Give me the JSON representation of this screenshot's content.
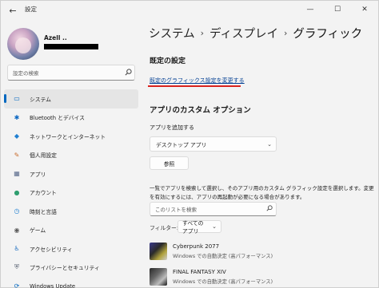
{
  "window": {
    "title": "設定",
    "back_glyph": "←",
    "minimize_glyph": "—",
    "maximize_glyph": "☐",
    "close_glyph": "✕"
  },
  "profile": {
    "name": "Azell .."
  },
  "search": {
    "placeholder": "設定の検索",
    "icon": "search-icon"
  },
  "sidebar": {
    "items": [
      {
        "label": "システム",
        "icon": "monitor-icon",
        "glyph": "▭",
        "color": "#0067c0",
        "active": true
      },
      {
        "label": "Bluetooth とデバイス",
        "icon": "bluetooth-icon",
        "glyph": "✱",
        "color": "#0a66c2"
      },
      {
        "label": "ネットワークとインターネット",
        "icon": "wifi-icon",
        "glyph": "◆",
        "color": "#1f7fd1"
      },
      {
        "label": "個人用設定",
        "icon": "pen-icon",
        "glyph": "✎",
        "color": "#c86b2a"
      },
      {
        "label": "アプリ",
        "icon": "apps-icon",
        "glyph": "▦",
        "color": "#5a6b8c"
      },
      {
        "label": "アカウント",
        "icon": "account-icon",
        "glyph": "●",
        "color": "#2f9e6f"
      },
      {
        "label": "時刻と言語",
        "icon": "globe-clock-icon",
        "glyph": "◷",
        "color": "#1f7fd1"
      },
      {
        "label": "ゲーム",
        "icon": "gamepad-icon",
        "glyph": "◉",
        "color": "#5b5b5b"
      },
      {
        "label": "アクセシビリティ",
        "icon": "accessibility-icon",
        "glyph": "♿",
        "color": "#1f6fc0"
      },
      {
        "label": "プライバシーとセキュリティ",
        "icon": "shield-icon",
        "glyph": "⛨",
        "color": "#5b6474"
      },
      {
        "label": "Windows Update",
        "icon": "update-icon",
        "glyph": "⟳",
        "color": "#0067c0"
      }
    ]
  },
  "breadcrumb": {
    "level1": "システム",
    "level2": "ディスプレイ",
    "current": "グラフィック",
    "separator": "›"
  },
  "default_settings": {
    "title": "既定の設定",
    "link": "既定のグラフィックス設定を変更する"
  },
  "custom_options": {
    "title": "アプリのカスタム オプション",
    "add_app_label": "アプリを追加する",
    "app_type_value": "デスクトップ アプリ",
    "browse_label": "参照",
    "description": "一覧でアプリを検索して選択し、そのアプリ用のカスタム グラフィック設定を選択します。変更を有効にするには、アプリの再起動が必要になる場合があります。",
    "list_search_placeholder": "このリストを検索",
    "filter_label": "フィルター:",
    "filter_value": "すべてのアプリ"
  },
  "apps": [
    {
      "name": "Cyberpunk 2077",
      "pref": "Windows での自動決定 (高パフォーマンス)"
    },
    {
      "name": "FINAL FANTASY XIV",
      "pref": "Windows での自動決定 (高パフォーマンス)"
    }
  ]
}
